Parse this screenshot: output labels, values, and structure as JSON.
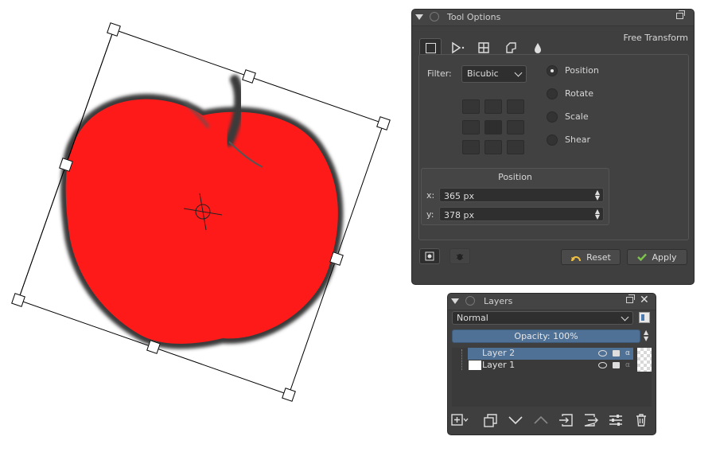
{
  "tool_options": {
    "title": "Tool Options",
    "mode_label": "Free Transform",
    "modes": [
      "free-transform-icon",
      "perspective-icon",
      "warp-icon",
      "cage-icon",
      "liquify-icon"
    ],
    "filter_label": "Filter:",
    "filter_value": "Bicubic",
    "radios": [
      {
        "label": "Position",
        "checked": true
      },
      {
        "label": "Rotate",
        "checked": false
      },
      {
        "label": "Scale",
        "checked": false
      },
      {
        "label": "Shear",
        "checked": false
      }
    ],
    "position_group_title": "Position",
    "x_label": "x:",
    "x_value": "365 px",
    "y_label": "y:",
    "y_value": "378 px",
    "reset_label": "Reset",
    "apply_label": "Apply"
  },
  "layers": {
    "title": "Layers",
    "blend_mode": "Normal",
    "opacity_label": "Opacity:  100%",
    "items": [
      {
        "name": "Layer 2",
        "selected": true
      },
      {
        "name": "Layer 1",
        "selected": false
      }
    ]
  },
  "colors": {
    "apple_fill": "#ff1a1a",
    "apple_outline": "#333333",
    "panel_bg": "#3f3f3f",
    "selection": "#4f7195",
    "apply_check": "#7ec44c"
  }
}
